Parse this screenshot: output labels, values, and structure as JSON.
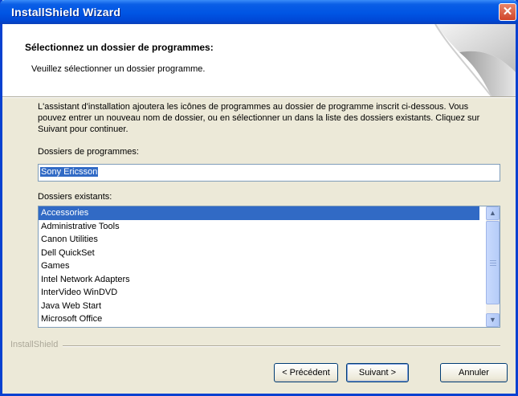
{
  "window": {
    "title": "InstallShield Wizard",
    "close_glyph": "✕"
  },
  "header": {
    "title": "Sélectionnez un dossier de programmes:",
    "subtitle": "Veuillez sélectionner un dossier programme."
  },
  "description": "L'assistant d'installation ajoutera les icônes de programmes au dossier de programme inscrit ci-dessous.  Vous pouvez entrer un nouveau nom de dossier, ou en sélectionner un dans la liste des dossiers existants.  Cliquez sur Suivant pour continuer.",
  "program_folder": {
    "label": "Dossiers de programmes:",
    "value": "Sony Ericsson"
  },
  "existing_folders": {
    "label": "Dossiers existants:",
    "items": [
      "Accessories",
      "Administrative Tools",
      "Canon Utilities",
      "Dell QuickSet",
      "Games",
      "Intel Network Adapters",
      "InterVideo WinDVD",
      "Java Web Start",
      "Microsoft Office"
    ],
    "selected_index": 0
  },
  "brand": "InstallShield",
  "buttons": {
    "back": "< Précédent",
    "next": "Suivant >",
    "cancel": "Annuler"
  },
  "icons": {
    "close": "close-icon",
    "scroll_up": "chevron-up-icon",
    "scroll_down": "chevron-down-icon"
  },
  "colors": {
    "titlebar": "#0055e4",
    "selection": "#316ac5",
    "dialog_bg": "#ece9d8"
  }
}
